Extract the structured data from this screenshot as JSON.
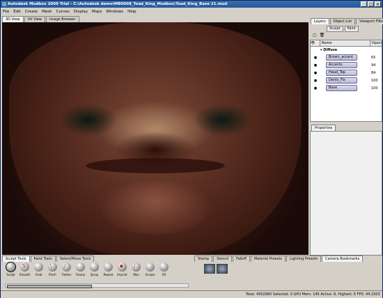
{
  "window": {
    "title": "Autodesk Mudbox 2009 Trial - C:\\Autodesk demo\\MB0008_Toad_King_Mudbox\\Toad_King_Base 21.mud"
  },
  "menu": [
    "File",
    "Edit",
    "Create",
    "Mesh",
    "Curves",
    "Display",
    "Maps",
    "Windows",
    "Help"
  ],
  "view_tabs": [
    "3D View",
    "UV View",
    "Image Browser"
  ],
  "right_tabs": [
    "Layers",
    "Object List",
    "Viewport Filters"
  ],
  "layer_subtabs": [
    "Sculpt",
    "Paint"
  ],
  "layers": {
    "col_name": "Name",
    "col_opacity": "Opaci",
    "group": "Diffuse",
    "rows": [
      {
        "name": "Brown_accent",
        "opacity": "65"
      },
      {
        "name": "Accents",
        "opacity": "94"
      },
      {
        "name": "Head_Top",
        "opacity": "84"
      },
      {
        "name": "Dents_Fix",
        "opacity": "100"
      },
      {
        "name": "Base",
        "opacity": "100"
      }
    ]
  },
  "properties_tab": "Properties",
  "shelf_tabs": [
    "Sculpt Tools",
    "Paint Tools",
    "Select/Move Tools"
  ],
  "tools": [
    "Sculpt",
    "Smooth",
    "Grab",
    "Pinch",
    "Flatten",
    "Foamy",
    "Spray",
    "Repeat",
    "Imprint",
    "Wax",
    "Scrape",
    "Fill"
  ],
  "bottom_tabs": [
    "Stamp",
    "Stencil",
    "Falloff",
    "Material Presets",
    "Lighting Presets",
    "Camera Bookmarks"
  ],
  "status": "Total: 4302960  Selected: 0  GPU Mem: 145  Active: 6, Highest: 6  FPS: 44.1503"
}
